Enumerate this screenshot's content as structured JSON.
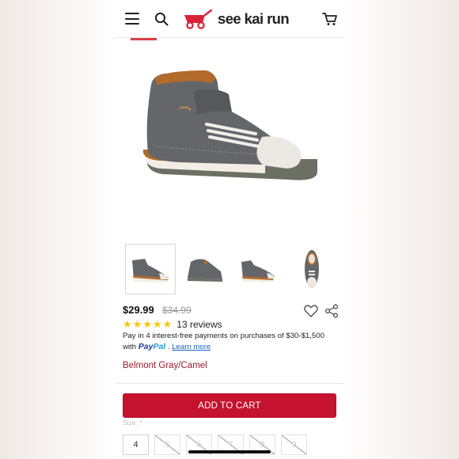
{
  "header": {
    "menu_icon": "hamburger-icon",
    "search_icon": "search-icon",
    "brand": "see kai run",
    "cart_icon": "cart-icon"
  },
  "product": {
    "price": "$29.99",
    "original_price": "$34.99",
    "rating": 5,
    "rating_stars": "★★★★★",
    "reviews": "13 reviews",
    "paypal": {
      "text_1": "Pay in 4 interest-free payments on purchases of $30-$1,500",
      "text_2": "with",
      "brand_part_1": "Pay",
      "brand_part_2": "Pal",
      "separator": " .",
      "link": "Learn more"
    },
    "color_name": "Belmont Gray/Camel",
    "thumbnails_count": 4,
    "selected_thumbnail": 1
  },
  "actions": {
    "add_to_cart": "ADD TO CART",
    "size_label": "Size: *",
    "sizes": [
      {
        "label": "4",
        "available": true
      },
      {
        "label": "5",
        "available": false
      },
      {
        "label": "6",
        "available": false
      },
      {
        "label": "7",
        "available": false
      },
      {
        "label": "8",
        "available": false
      },
      {
        "label": "9",
        "available": false
      }
    ]
  },
  "colors": {
    "accent": "#c4122f",
    "brand_red": "#d9243a",
    "star": "#f5c60a",
    "color_name": "#9b1c2b",
    "link": "#1a64c8"
  }
}
